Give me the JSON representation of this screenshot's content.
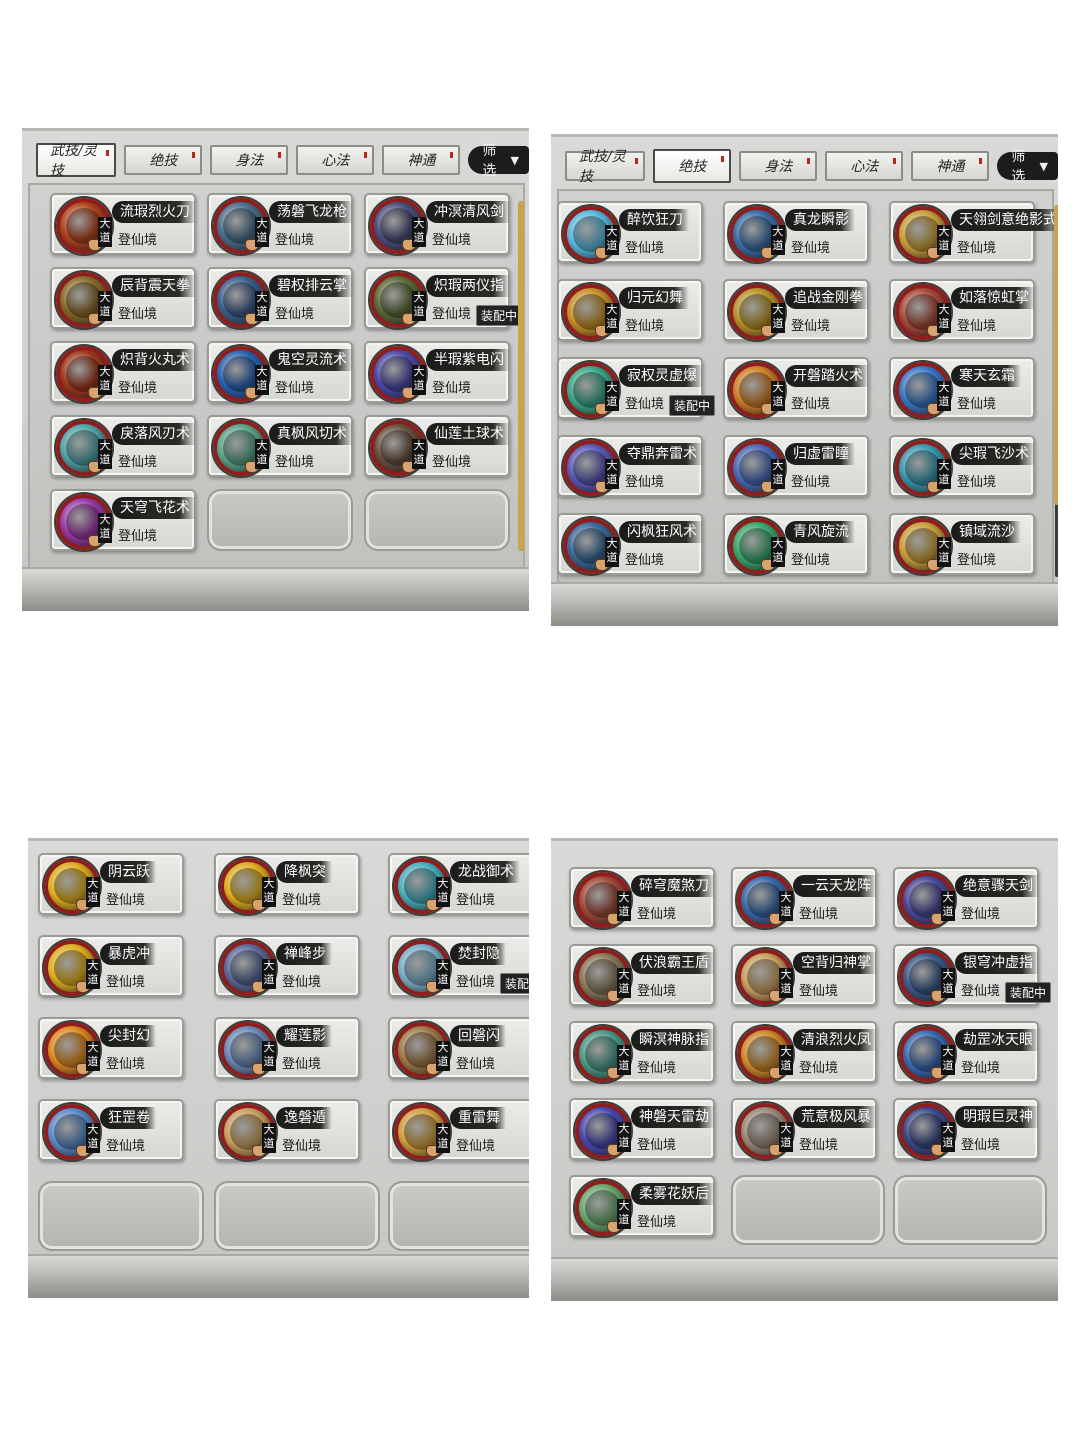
{
  "tabs": [
    {
      "label": "武技/灵技"
    },
    {
      "label": "绝技"
    },
    {
      "label": "身法"
    },
    {
      "label": "心法"
    },
    {
      "label": "神通"
    }
  ],
  "filter_label": "筛选",
  "filter_icon": "triangle-down-icon",
  "badge_text": "大道",
  "realm_label": "登仙境",
  "equipped_label": "装配中",
  "panels": [
    {
      "id": "wuji",
      "active_tab": 0,
      "skills": [
        {
          "name": "流瑕烈火刀",
          "color": "#b2441e",
          "equipped": false
        },
        {
          "name": "荡磐飞龙枪",
          "color": "#4b6e8c",
          "equipped": false
        },
        {
          "name": "冲溟清风剑",
          "color": "#4a4f7c",
          "equipped": false
        },
        {
          "name": "辰背震天拳",
          "color": "#8a6a2a",
          "equipped": false
        },
        {
          "name": "碧权排云掌",
          "color": "#3d5f8e",
          "equipped": false
        },
        {
          "name": "炽瑕两仪指",
          "color": "#5c6a3a",
          "equipped": true
        },
        {
          "name": "炽背火丸术",
          "color": "#a0381e",
          "equipped": false
        },
        {
          "name": "鬼空灵流术",
          "color": "#2a62b0",
          "equipped": false
        },
        {
          "name": "半瑕紫电闪",
          "color": "#4b4aa8",
          "equipped": false
        },
        {
          "name": "戾落风刃术",
          "color": "#4fa3a8",
          "equipped": false
        },
        {
          "name": "真枫风切术",
          "color": "#5aa58a",
          "equipped": false
        },
        {
          "name": "仙莲土球术",
          "color": "#6a5040",
          "equipped": false
        },
        {
          "name": "天穹飞花术",
          "color": "#9a3aa8",
          "equipped": false
        }
      ],
      "empty_slots": 2
    },
    {
      "id": "jueji",
      "active_tab": 1,
      "skills": [
        {
          "name": "醉饮狂刀",
          "color": "#58b8e0",
          "equipped": false
        },
        {
          "name": "真龙瞬影",
          "color": "#3a6ea8",
          "equipped": false
        },
        {
          "name": "天翎剑意绝影式",
          "color": "#c9a03a",
          "equipped": false
        },
        {
          "name": "归元幻舞",
          "color": "#c9902a",
          "equipped": false
        },
        {
          "name": "追战金刚拳",
          "color": "#b8952a",
          "equipped": false
        },
        {
          "name": "如落惊虹掌",
          "color": "#a84a3a",
          "equipped": false
        },
        {
          "name": "寂权灵虚爆",
          "color": "#3aa88a",
          "equipped": true
        },
        {
          "name": "开磐踏火术",
          "color": "#d0802a",
          "equipped": false
        },
        {
          "name": "寒天玄霜",
          "color": "#3a78c8",
          "equipped": false
        },
        {
          "name": "夺鼎奔雷术",
          "color": "#5a5ab8",
          "equipped": false
        },
        {
          "name": "归虚雷瞳",
          "color": "#4a6ab8",
          "equipped": false
        },
        {
          "name": "尖瑕飞沙术",
          "color": "#3a9ab0",
          "equipped": false
        },
        {
          "name": "闪枫狂风术",
          "color": "#3a6a9a",
          "equipped": false
        },
        {
          "name": "青风旋流",
          "color": "#3aa870",
          "equipped": false
        },
        {
          "name": "镇域流沙",
          "color": "#c9a03a",
          "equipped": false
        }
      ],
      "empty_slots": 0
    },
    {
      "id": "shenfa",
      "active_tab": 2,
      "skills": [
        {
          "name": "阴云跃",
          "color": "#e0b020",
          "equipped": false
        },
        {
          "name": "降枫突",
          "color": "#e0b020",
          "equipped": false
        },
        {
          "name": "龙战御术",
          "color": "#4ab0c0",
          "equipped": false
        },
        {
          "name": "暴虎冲",
          "color": "#e0b020",
          "equipped": false
        },
        {
          "name": "禅峰步",
          "color": "#5a6a9a",
          "equipped": false
        },
        {
          "name": "焚封隐",
          "color": "#7ab0c8",
          "equipped": true
        },
        {
          "name": "尖封幻",
          "color": "#e08a20",
          "equipped": false
        },
        {
          "name": "耀莲影",
          "color": "#6a8ab8",
          "equipped": false
        },
        {
          "name": "回磐闪",
          "color": "#a07a4a",
          "equipped": false
        },
        {
          "name": "狂罡卷",
          "color": "#5a8ac8",
          "equipped": false
        },
        {
          "name": "逸磐遁",
          "color": "#c8a060",
          "equipped": false
        },
        {
          "name": "重雷舞",
          "color": "#d0a040",
          "equipped": false
        }
      ],
      "empty_slots": 3
    },
    {
      "id": "shentong",
      "active_tab": 4,
      "skills": [
        {
          "name": "碎穹魔煞刀",
          "color": "#a04a3a",
          "equipped": false
        },
        {
          "name": "一云天龙阵",
          "color": "#3a6aa8",
          "equipped": false
        },
        {
          "name": "绝意骤天剑",
          "color": "#4a4a9a",
          "equipped": false
        },
        {
          "name": "伏浪霸王盾",
          "color": "#8a7a5a",
          "equipped": false
        },
        {
          "name": "空背归神掌",
          "color": "#c8a060",
          "equipped": false
        },
        {
          "name": "银穹冲虚指",
          "color": "#3a5a8a",
          "equipped": true
        },
        {
          "name": "瞬溟神脉指",
          "color": "#4a9a8a",
          "equipped": false
        },
        {
          "name": "清浪烈火凤",
          "color": "#d08a2a",
          "equipped": false
        },
        {
          "name": "劫罡冰天眼",
          "color": "#3a6ab0",
          "equipped": false
        },
        {
          "name": "神磐天雷劫",
          "color": "#4a4ab0",
          "equipped": false
        },
        {
          "name": "荒意极风暴",
          "color": "#9a8a7a",
          "equipped": false
        },
        {
          "name": "明瑕巨灵神",
          "color": "#3a4a8a",
          "equipped": false
        },
        {
          "name": "柔雾花妖后",
          "color": "#6aa870",
          "equipped": false
        }
      ],
      "empty_slots": 2
    }
  ]
}
